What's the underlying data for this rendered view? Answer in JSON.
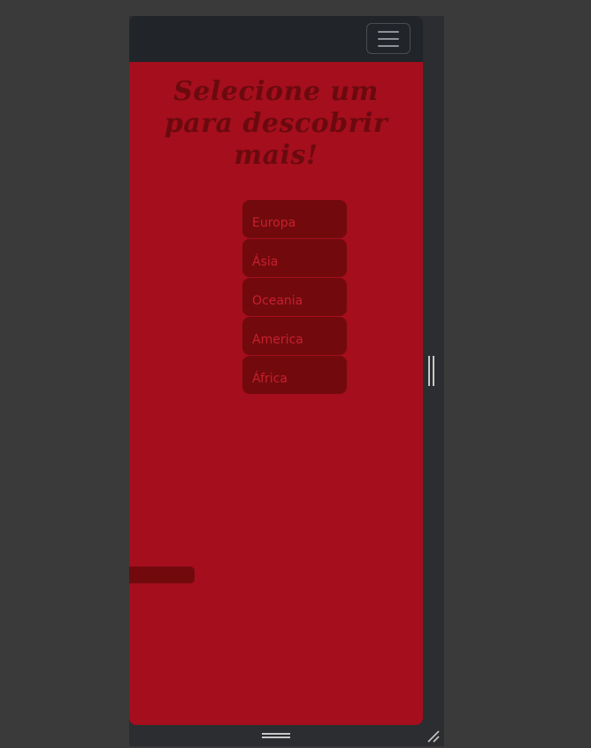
{
  "navbar": {
    "toggler_icon": "hamburger-menu-icon"
  },
  "main": {
    "heading": "Selecione um para descobrir mais!",
    "continents": [
      {
        "label": "Europa"
      },
      {
        "label": "Ásia"
      },
      {
        "label": "Oceania"
      },
      {
        "label": "America"
      },
      {
        "label": "África"
      }
    ]
  },
  "device_frame": {
    "side_handle_icon": "vertical-resize-handle-icon",
    "bottom_handle_icon": "horizontal-resize-handle-icon",
    "corner_icon": "resize-corner-icon"
  },
  "colors": {
    "page_background": "#a50e1c",
    "navbar": "#212529",
    "button_background": "#720a0d",
    "button_text": "#c6202d",
    "heading_text": "#6a0a0f",
    "outer_background": "#3a3a3a"
  }
}
